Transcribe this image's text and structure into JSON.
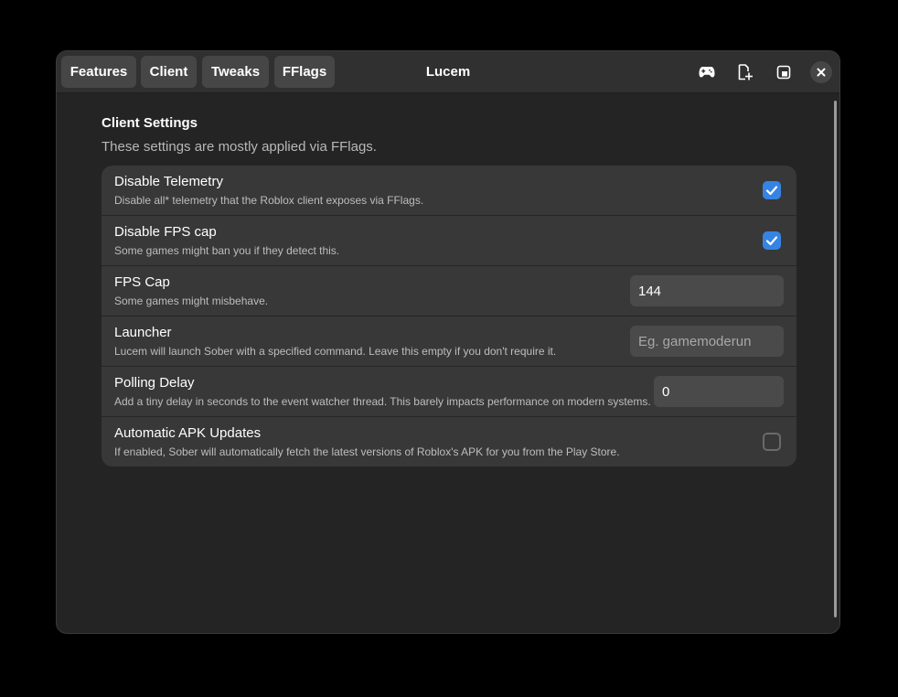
{
  "header": {
    "tabs": [
      {
        "label": "Features"
      },
      {
        "label": "Client"
      },
      {
        "label": "Tweaks"
      },
      {
        "label": "FFlags"
      }
    ],
    "title": "Lucem",
    "icons": [
      "gamepad-icon",
      "new-document-icon",
      "window-icon",
      "close-icon"
    ]
  },
  "section": {
    "title": "Client Settings",
    "subtitle": "These settings are mostly applied via FFlags."
  },
  "settings": [
    {
      "title": "Disable Telemetry",
      "description": "Disable all* telemetry that the Roblox client exposes via FFlags.",
      "control": "checkbox",
      "checked": true
    },
    {
      "title": "Disable FPS cap",
      "description": "Some games might ban you if they detect this.",
      "control": "checkbox",
      "checked": true
    },
    {
      "title": "FPS Cap",
      "description": "Some games might misbehave.",
      "control": "entry",
      "value": "144",
      "placeholder": ""
    },
    {
      "title": "Launcher",
      "description": "Lucem will launch Sober with a specified command. Leave this empty if you don't require it.",
      "control": "entry",
      "value": "",
      "placeholder": "Eg. gamemoderun"
    },
    {
      "title": "Polling Delay",
      "description": "Add a tiny delay in seconds to the event watcher thread. This barely impacts performance on modern systems.",
      "control": "entry",
      "value": "0",
      "placeholder": ""
    },
    {
      "title": "Automatic APK Updates",
      "description": "If enabled, Sober will automatically fetch the latest versions of Roblox's APK for you from the Play Store.",
      "control": "checkbox",
      "checked": false
    }
  ],
  "colors": {
    "window_bg": "#242424",
    "header_bg": "#303030",
    "row_bg": "#383838",
    "accent": "#3584e4"
  }
}
